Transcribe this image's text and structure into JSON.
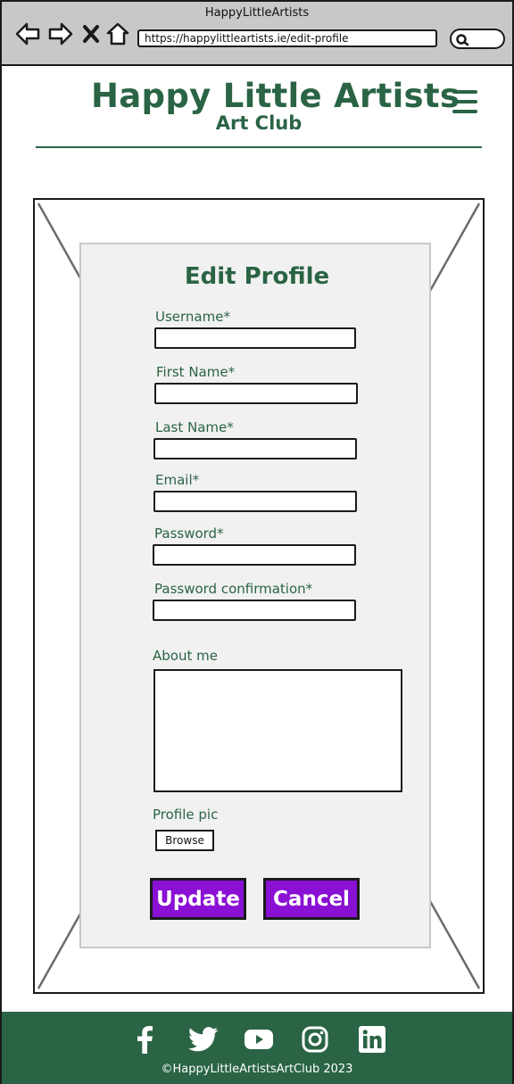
{
  "browser": {
    "window_title": "HappyLittleArtists",
    "url": "https://happylittleartists.ie/edit-profile"
  },
  "header": {
    "title": "Happy Little Artists",
    "subtitle": "Art Club"
  },
  "form": {
    "heading": "Edit Profile",
    "fields": [
      {
        "label": "Username*",
        "value": ""
      },
      {
        "label": "First Name*",
        "value": ""
      },
      {
        "label": "Last Name*",
        "value": ""
      },
      {
        "label": "Email*",
        "value": ""
      },
      {
        "label": "Password*",
        "value": ""
      },
      {
        "label": "Password confirmation*",
        "value": ""
      }
    ],
    "about": {
      "label": "About me",
      "value": ""
    },
    "profile_pic": {
      "label": "Profile pic",
      "browse_label": "Browse"
    },
    "update_label": "Update",
    "cancel_label": "Cancel"
  },
  "footer": {
    "social_icons": [
      "facebook-icon",
      "twitter-icon",
      "youtube-icon",
      "instagram-icon",
      "linkedin-icon"
    ],
    "copyright": "©HappyLittleArtistsArtClub 2023"
  },
  "colors": {
    "brand_green": "#2a6445",
    "button_purple": "#8a10d4",
    "panel_bg": "#f1f1f1",
    "chrome_bg": "#c8c8c8"
  }
}
